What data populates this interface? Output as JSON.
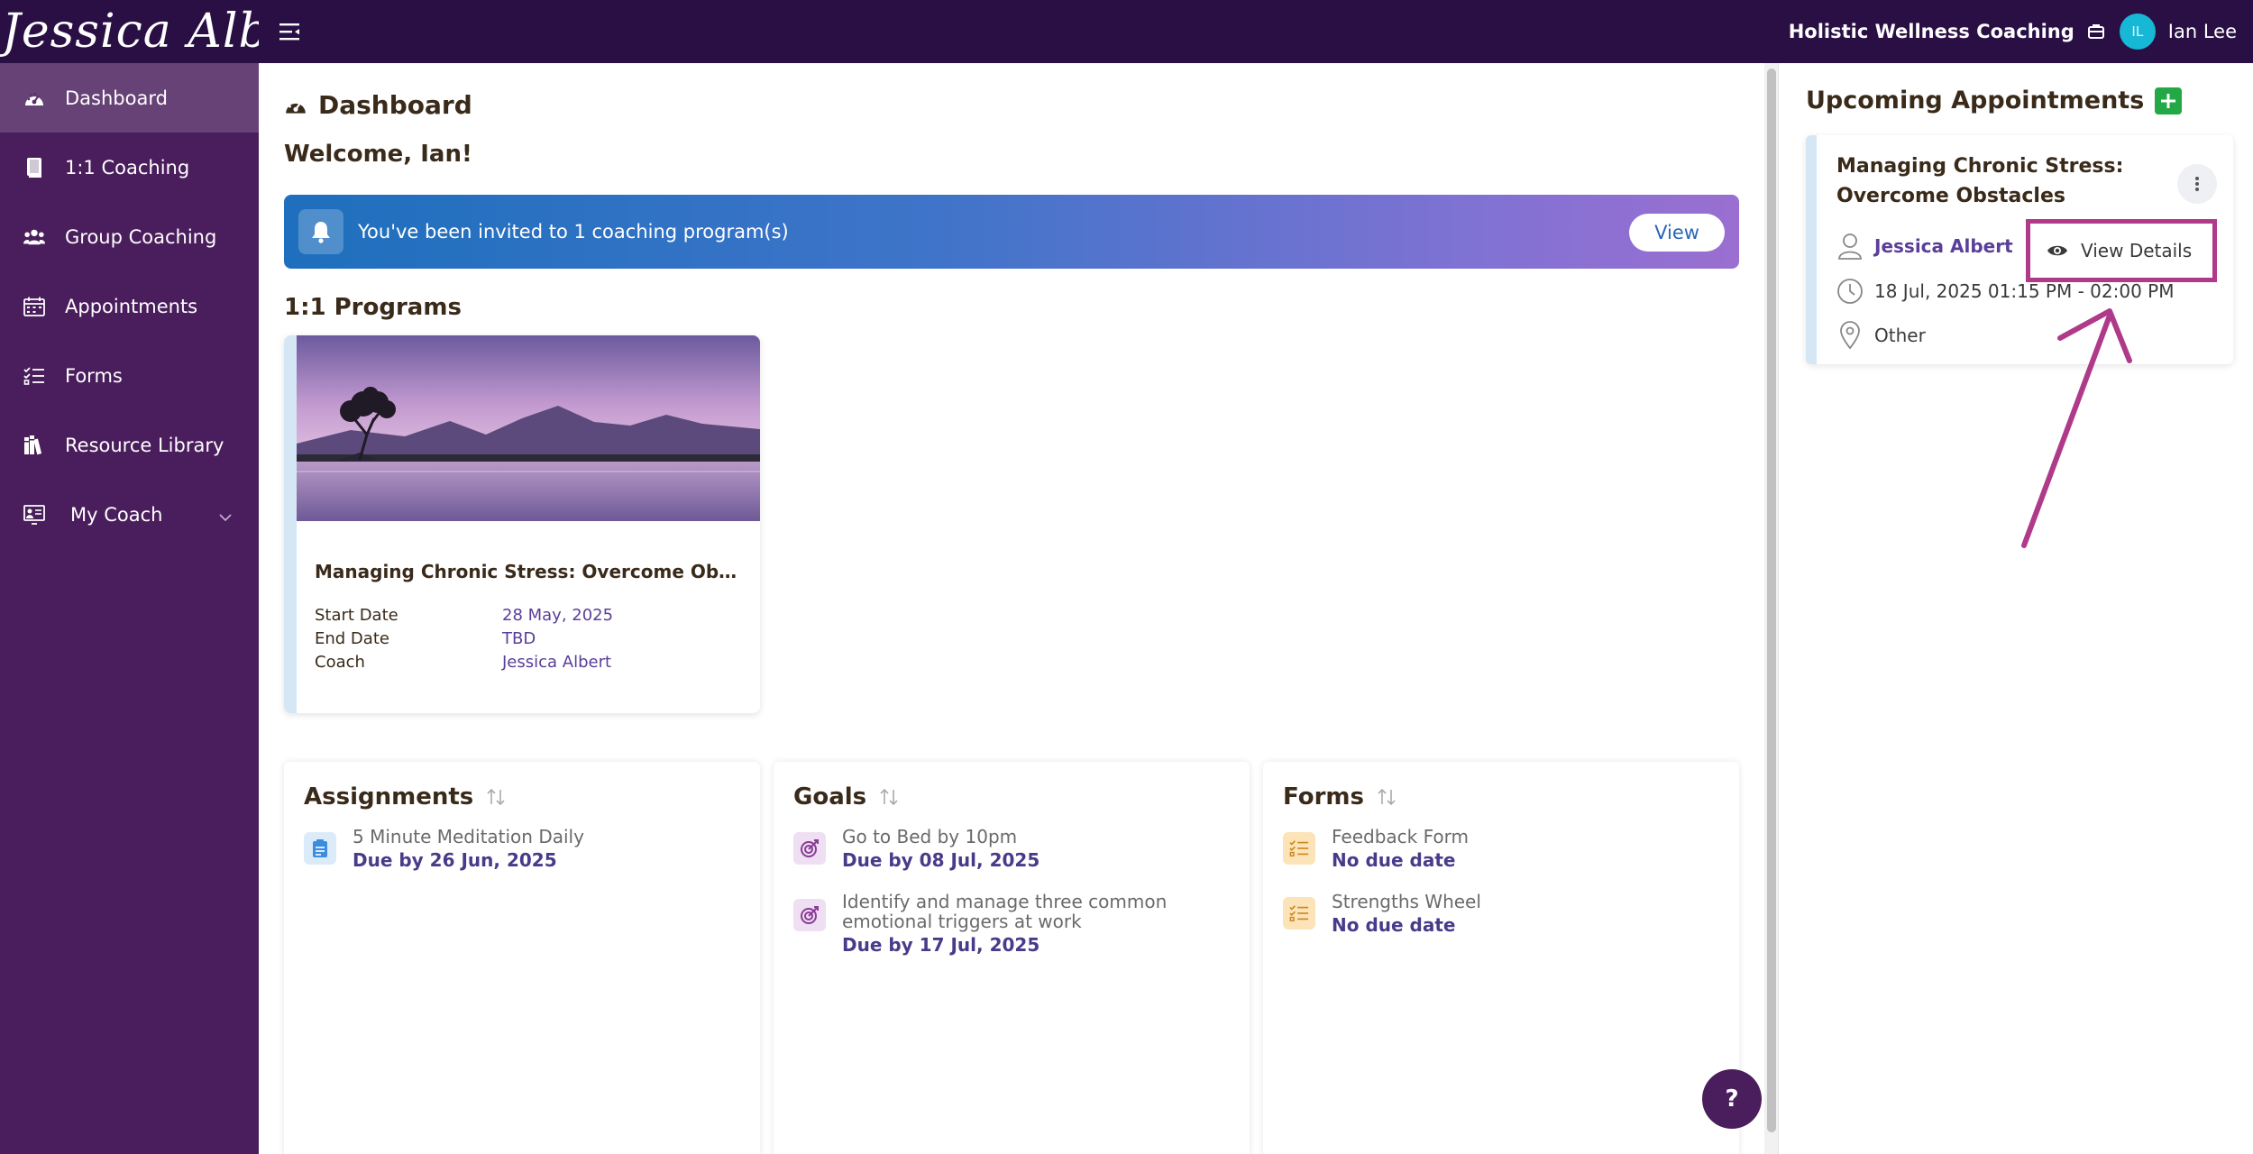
{
  "header": {
    "brand": "Jessica Albert",
    "org_name": "Holistic Wellness Coaching",
    "avatar_initials": "IL",
    "user_name": "Ian Lee"
  },
  "sidebar": {
    "items": [
      {
        "label": "Dashboard",
        "icon": "dashboard-icon",
        "active": true
      },
      {
        "label": "1:1 Coaching",
        "icon": "book-icon"
      },
      {
        "label": "Group Coaching",
        "icon": "users-icon"
      },
      {
        "label": "Appointments",
        "icon": "calendar-icon"
      },
      {
        "label": "Forms",
        "icon": "checklist-icon"
      },
      {
        "label": "Resource Library",
        "icon": "library-icon"
      },
      {
        "label": "My Coach",
        "icon": "coach-icon",
        "expandable": true
      }
    ]
  },
  "main": {
    "title": "Dashboard",
    "welcome": "Welcome, Ian!",
    "banner": {
      "text": "You've been invited to 1 coaching program(s)",
      "button": "View"
    },
    "programs_title": "1:1 Programs",
    "program": {
      "name": "Managing Chronic Stress: Overcome Obsta...",
      "start_label": "Start Date",
      "start_value": "28 May, 2025",
      "end_label": "End Date",
      "end_value": "TBD",
      "coach_label": "Coach",
      "coach_value": "Jessica Albert"
    },
    "assignments": {
      "title": "Assignments",
      "items": [
        {
          "name": "5 Minute Meditation Daily",
          "due": "Due by 26 Jun, 2025"
        }
      ]
    },
    "goals": {
      "title": "Goals",
      "items": [
        {
          "name": "Go to Bed by 10pm",
          "due": "Due by 08 Jul, 2025"
        },
        {
          "name": "Identify and manage three common emotional triggers at work",
          "due": "Due by 17 Jul, 2025"
        }
      ]
    },
    "forms": {
      "title": "Forms",
      "items": [
        {
          "name": "Feedback Form",
          "due": "No due date"
        },
        {
          "name": "Strengths Wheel",
          "due": "No due date"
        }
      ]
    },
    "help": "?"
  },
  "appointments": {
    "title": "Upcoming Appointments",
    "card": {
      "title": "Managing Chronic Stress: Overcome Obstacles",
      "coach": "Jessica Albert",
      "datetime": "18 Jul, 2025 01:15 PM - 02:00 PM",
      "location": "Other"
    },
    "menu_view_details": "View Details"
  },
  "colors": {
    "topbar": "#2a0f45",
    "sidebar": "#4a1e5c",
    "accent": "#b03a8a",
    "link": "#5a3e98",
    "add": "#22a845"
  }
}
